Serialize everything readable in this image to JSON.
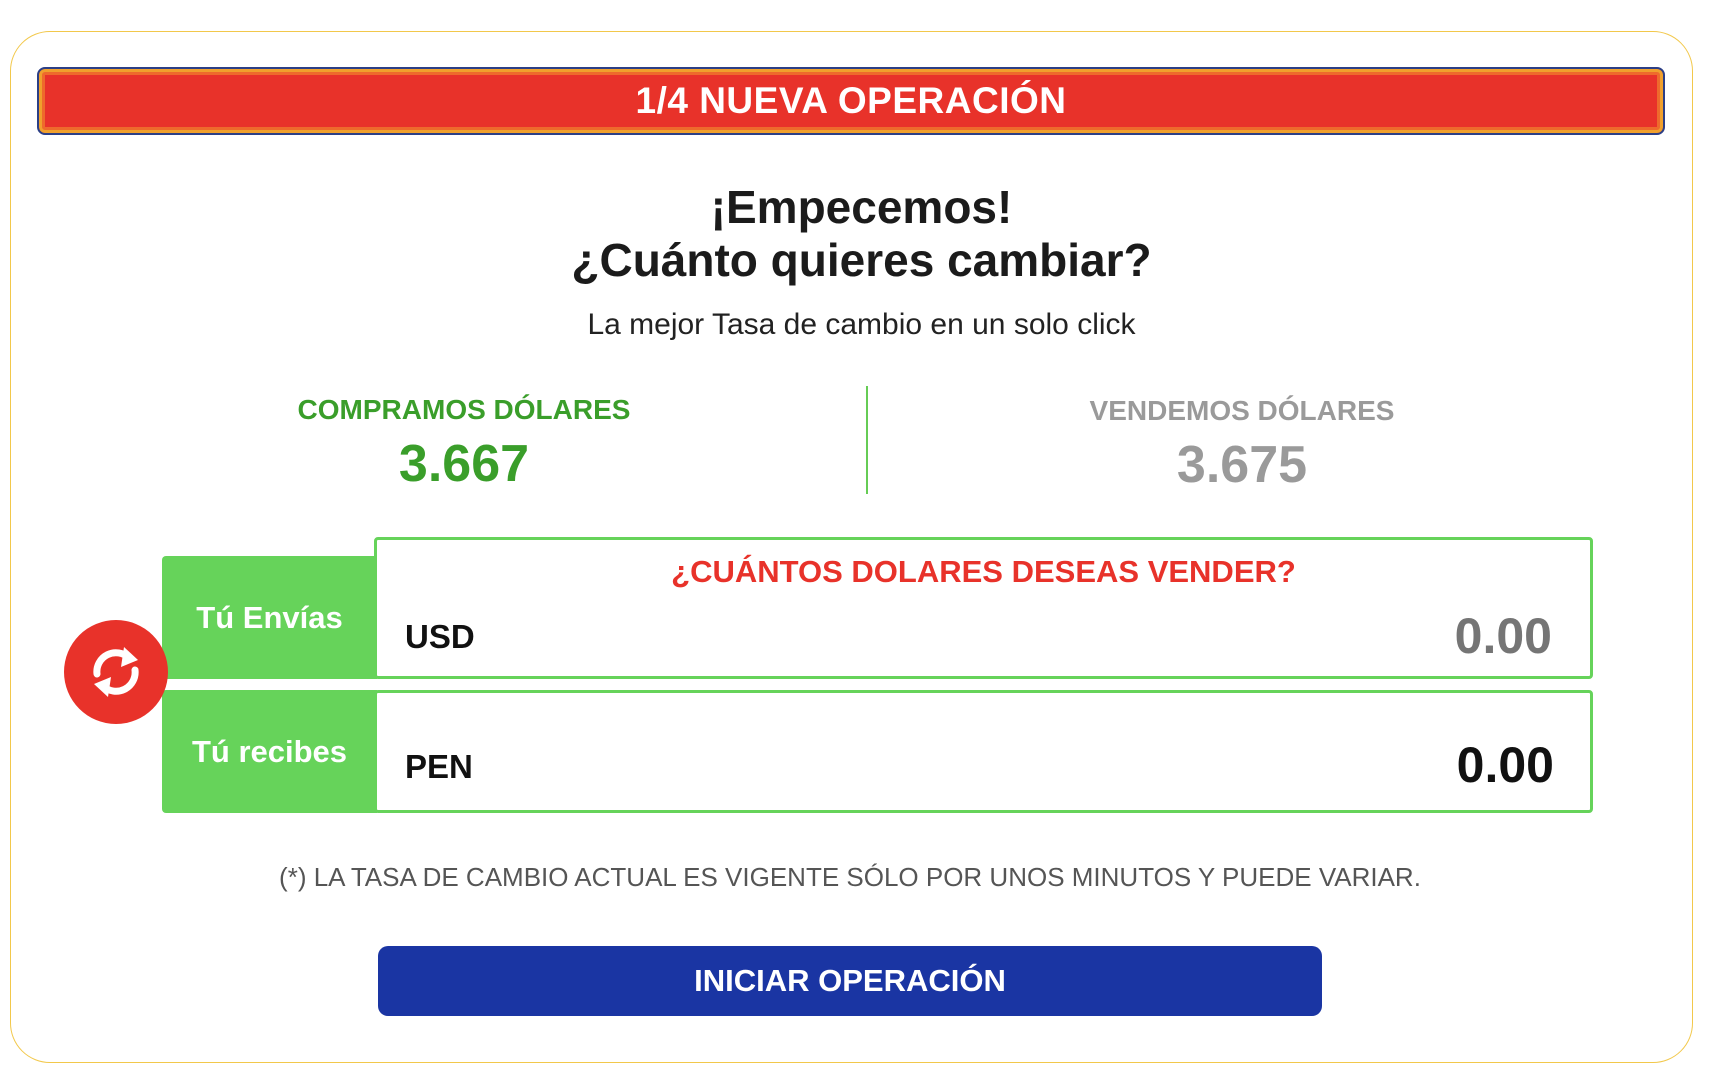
{
  "banner": {
    "step_title": "1/4 NUEVA OPERACIÓN"
  },
  "intro": {
    "heading_line1": "¡Empecemos!",
    "heading_line2": "¿Cuánto quieres cambiar?",
    "subtitle": "La mejor Tasa de cambio en un solo click"
  },
  "rates": {
    "buy": {
      "label": "COMPRAMOS DÓLARES",
      "value": "3.667",
      "color": "#3a9e2a",
      "active": true
    },
    "sell": {
      "label": "VENDEMOS DÓLARES",
      "value": "3.675",
      "color": "#9a9a9a",
      "active": false
    }
  },
  "exchange": {
    "send": {
      "tab_label": "Tú Envías",
      "question": "¿CUÁNTOS DOLARES DESEAS VENDER?",
      "currency": "USD",
      "placeholder": "0.00"
    },
    "receive": {
      "tab_label": "Tú recibes",
      "currency": "PEN",
      "amount": "0.00"
    },
    "swap_icon": "swap-arrows-icon"
  },
  "disclaimer": "(*) LA TASA DE CAMBIO ACTUAL ES VIGENTE SÓLO POR UNOS MINUTOS Y PUEDE VARIAR.",
  "actions": {
    "start_label": "INICIAR OPERACIÓN"
  },
  "colors": {
    "brand_red": "#e8322a",
    "brand_green": "#66d35a",
    "brand_blue": "#1a35a3",
    "card_border": "#f2c84b"
  }
}
